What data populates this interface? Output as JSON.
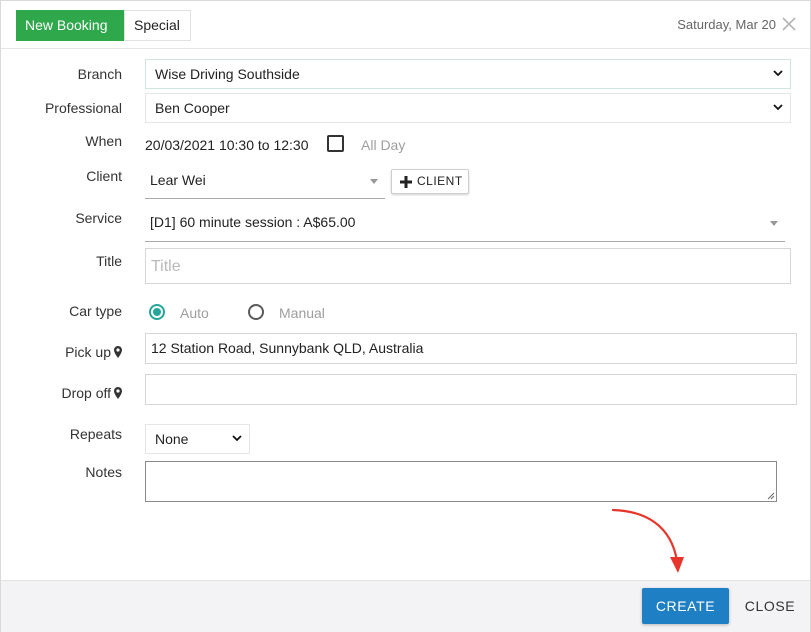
{
  "header": {
    "tabs": [
      {
        "label": "New Booking",
        "active": true
      },
      {
        "label": "Special",
        "active": false
      }
    ],
    "date": "Saturday, Mar 20",
    "close_icon": "close-icon"
  },
  "form": {
    "branch": {
      "label": "Branch",
      "value": "Wise Driving Southside"
    },
    "professional": {
      "label": "Professional",
      "value": "Ben Cooper"
    },
    "when": {
      "label": "When",
      "value": "20/03/2021 10:30 to 12:30",
      "all_day_label": "All Day",
      "all_day_checked": false
    },
    "client": {
      "label": "Client",
      "value": "Lear Wei",
      "add_button_label": "CLIENT"
    },
    "service": {
      "label": "Service",
      "value": "[D1] 60 minute session : A$65.00"
    },
    "title": {
      "label": "Title",
      "value": "",
      "placeholder": "Title"
    },
    "car_type": {
      "label": "Car type",
      "options": [
        {
          "label": "Auto",
          "selected": true
        },
        {
          "label": "Manual",
          "selected": false
        }
      ]
    },
    "pick_up": {
      "label": "Pick up",
      "value": "12 Station Road, Sunnybank QLD, Australia"
    },
    "drop_off": {
      "label": "Drop off",
      "value": ""
    },
    "repeats": {
      "label": "Repeats",
      "value": "None"
    },
    "notes": {
      "label": "Notes",
      "value": ""
    }
  },
  "footer": {
    "create_label": "CREATE",
    "close_label": "CLOSE"
  },
  "colors": {
    "tab_active": "#2ea84b",
    "radio_accent": "#26a69a",
    "create_button": "#1f7fc4",
    "annotation_arrow": "#e8352b"
  }
}
